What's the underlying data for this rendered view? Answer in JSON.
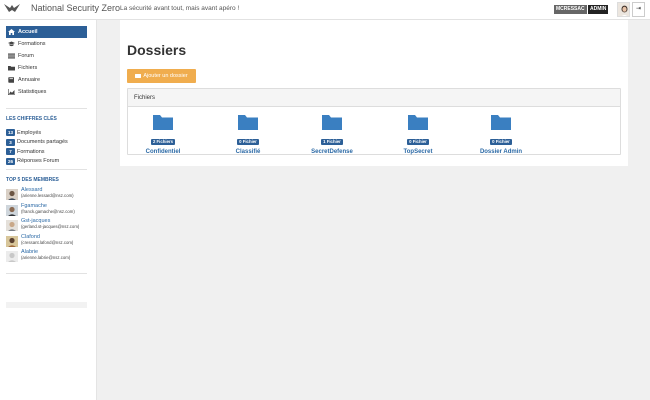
{
  "header": {
    "app_title": "National Security Zero",
    "tagline": "La sécurité avant tout, mais avant apéro !",
    "user_label": "MCRESSAC",
    "role_label": "ADMIN",
    "logout_icon": "⇥"
  },
  "sidebar": {
    "nav": [
      {
        "label": "Accueil",
        "icon": "home-icon",
        "active": true
      },
      {
        "label": "Formations",
        "icon": "graduation-cap-icon"
      },
      {
        "label": "Forum",
        "icon": "list-icon"
      },
      {
        "label": "Fichiers",
        "icon": "folder-icon"
      },
      {
        "label": "Annuaire",
        "icon": "book-icon"
      },
      {
        "label": "Statistiques",
        "icon": "area-chart-icon"
      }
    ],
    "stats_title": "LES CHIFFRES CLÉS",
    "stats": [
      {
        "count": "13",
        "label": "Employés"
      },
      {
        "count": "3",
        "label": "Documents partagés"
      },
      {
        "count": "7",
        "label": "Formations"
      },
      {
        "count": "26",
        "label": "Réponses Forum"
      }
    ],
    "members_title": "TOP 5 DES MEMBRES",
    "members": [
      {
        "name": "Alessard",
        "email": "(arienne.lessard@nsz.com)"
      },
      {
        "name": "Fgamache",
        "email": "(franck.gamache@nsz.com)"
      },
      {
        "name": "Gst-jacques",
        "email": "(gerland.st-jacques@nsz.com)"
      },
      {
        "name": "Clafond",
        "email": "(cressant.lafond@nsz.com)"
      },
      {
        "name": "Alabrie",
        "email": "(arienne.labrie@nsz.com)"
      }
    ]
  },
  "main": {
    "title": "Dossiers",
    "add_button": "Ajouter un dossier",
    "panel_title": "Fichiers",
    "folders": [
      {
        "name": "Confidentiel",
        "count": "2 Fichiers"
      },
      {
        "name": "Classifié",
        "count": "0 Fichier"
      },
      {
        "name": "SecretDefense",
        "count": "1 Fichier"
      },
      {
        "name": "TopSecret",
        "count": "0 Fichier"
      },
      {
        "name": "Dossier Admin",
        "count": "0 Fichier"
      }
    ]
  },
  "colors": {
    "accent": "#2c5f97",
    "link": "#2c6aa6",
    "add_button": "#f0ad4e",
    "folder": "#3a7fc1"
  }
}
